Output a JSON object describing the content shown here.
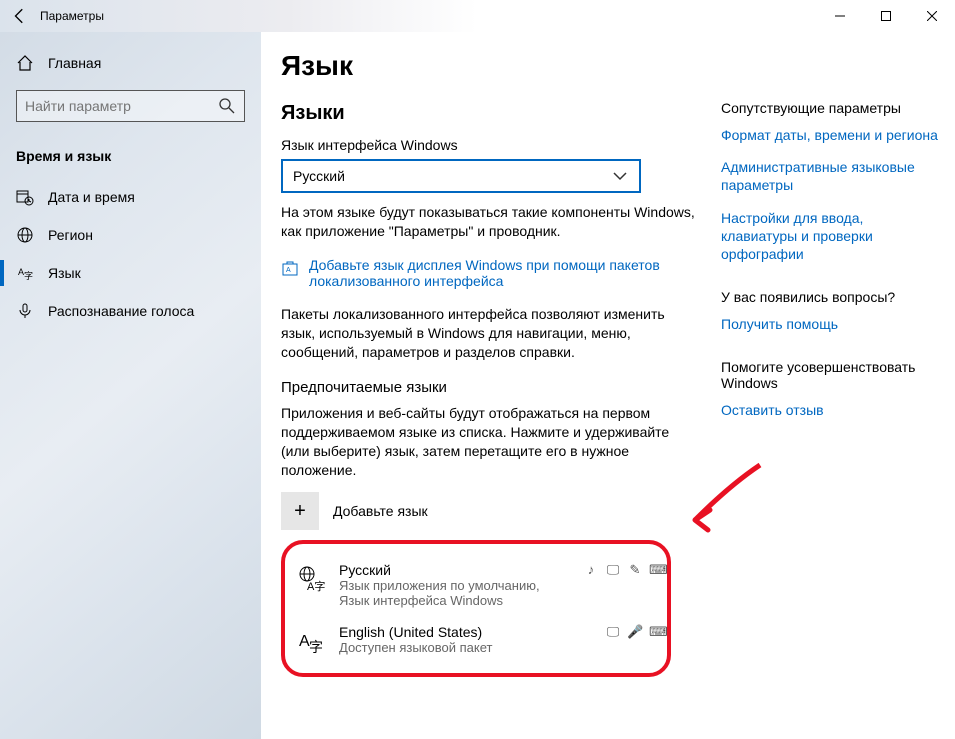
{
  "window": {
    "title": "Параметры"
  },
  "sidebar": {
    "home": "Главная",
    "search_placeholder": "Найти параметр",
    "category": "Время и язык",
    "items": [
      {
        "label": "Дата и время"
      },
      {
        "label": "Регион"
      },
      {
        "label": "Язык"
      },
      {
        "label": "Распознавание голоса"
      }
    ]
  },
  "main": {
    "page_title": "Язык",
    "section1_title": "Языки",
    "ui_lang_label": "Язык интерфейса Windows",
    "ui_lang_value": "Русский",
    "ui_lang_desc": "На этом языке будут показываться такие компоненты Windows, как приложение \"Параметры\" и проводник.",
    "add_display_lang_link": "Добавьте язык дисплея Windows при помощи пакетов локализованного интерфейса",
    "lip_desc": "Пакеты локализованного интерфейса позволяют изменить язык, используемый в Windows для навигации, меню, сообщений, параметров и разделов справки.",
    "pref_title": "Предпочитаемые языки",
    "pref_desc": "Приложения и веб-сайты будут отображаться на первом поддерживаемом языке из списка. Нажмите и удерживайте (или выберите) язык, затем перетащите его в нужное положение.",
    "add_lang": "Добавьте язык",
    "langs": [
      {
        "name": "Русский",
        "sub": "Язык приложения по умолчанию, Язык интерфейса Windows"
      },
      {
        "name": "English (United States)",
        "sub": "Доступен языковой пакет"
      }
    ]
  },
  "related": {
    "header1": "Сопутствующие параметры",
    "link1": "Формат даты, времени и региона",
    "link2": "Административные языковые параметры",
    "link3": "Настройки для ввода, клавиатуры и проверки орфографии",
    "header2": "У вас появились вопросы?",
    "link4": "Получить помощь",
    "header3": "Помогите усовершенствовать Windows",
    "link5": "Оставить отзыв"
  }
}
